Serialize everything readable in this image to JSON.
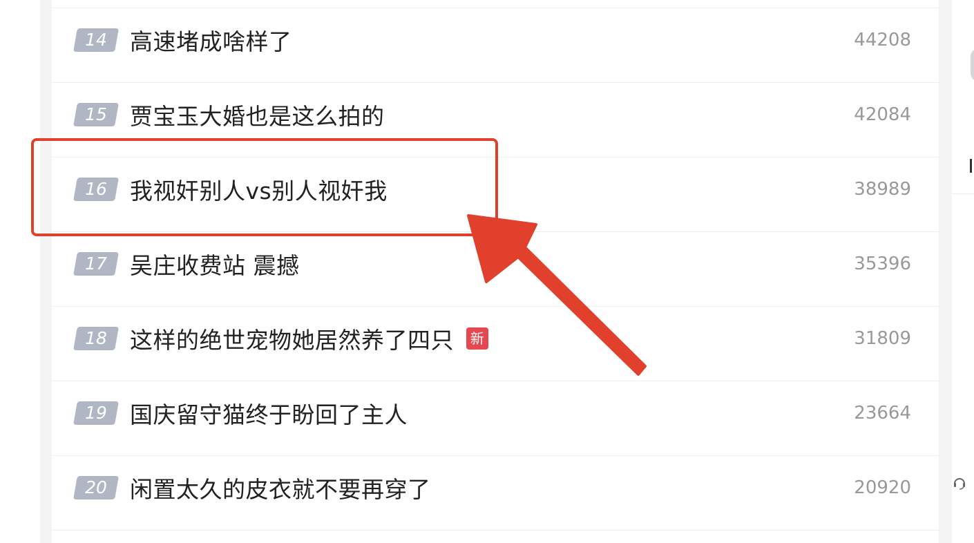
{
  "hot_list": [
    {
      "rank": "14",
      "title": "高速堵成啥样了",
      "count": "44208",
      "new_tag": ""
    },
    {
      "rank": "15",
      "title": "贾宝玉大婚也是这么拍的",
      "count": "42084",
      "new_tag": ""
    },
    {
      "rank": "16",
      "title": "我视奸别人vs别人视奸我",
      "count": "38989",
      "new_tag": ""
    },
    {
      "rank": "17",
      "title": "吴庄收费站 震撼",
      "count": "35396",
      "new_tag": ""
    },
    {
      "rank": "18",
      "title": "这样的绝世宠物她居然养了四只",
      "count": "31809",
      "new_tag": "新"
    },
    {
      "rank": "19",
      "title": "国庆留守猫终于盼回了主人",
      "count": "23664",
      "new_tag": ""
    },
    {
      "rank": "20",
      "title": "闲置太久的皮衣就不要再穿了",
      "count": "20920",
      "new_tag": ""
    }
  ],
  "annotation": {
    "highlight_color": "#e0402c",
    "highlighted_rank": "16"
  },
  "sidebar": {
    "support_icon": "headset-icon"
  }
}
